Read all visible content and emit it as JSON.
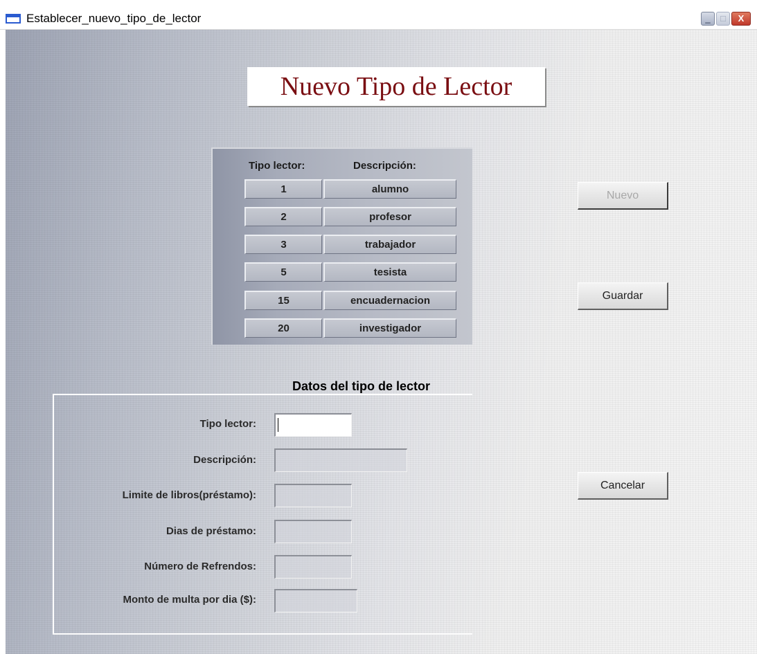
{
  "window": {
    "title": "Establecer_nuevo_tipo_de_lector",
    "minimize_glyph": "_",
    "maximize_glyph": "□",
    "close_glyph": "X"
  },
  "heading": "Nuevo Tipo de Lector",
  "table": {
    "headers": [
      "Tipo lector:",
      "Descripción:"
    ],
    "rows": [
      {
        "id": "1",
        "desc": "alumno"
      },
      {
        "id": "2",
        "desc": "profesor"
      },
      {
        "id": "3",
        "desc": "trabajador"
      },
      {
        "id": "5",
        "desc": "tesista"
      },
      {
        "id": "15",
        "desc": "encuadernacion"
      },
      {
        "id": "20",
        "desc": "investigador"
      }
    ]
  },
  "buttons": {
    "nuevo": "Nuevo",
    "guardar": "Guardar",
    "cancelar": "Cancelar"
  },
  "form": {
    "legend": "Datos del tipo de lector",
    "labels": {
      "tipo_lector": "Tipo lector:",
      "descripcion": "Descripción:",
      "limite_libros": "Limite de libros(préstamo):",
      "dias_prestamo": "Dias de préstamo:",
      "numero_refrendos": "Número de Refrendos:",
      "monto_multa": "Monto de multa por dia ($):"
    },
    "values": {
      "tipo_lector": "",
      "descripcion": "",
      "limite_libros": "",
      "dias_prestamo": "",
      "numero_refrendos": "",
      "monto_multa": ""
    }
  }
}
